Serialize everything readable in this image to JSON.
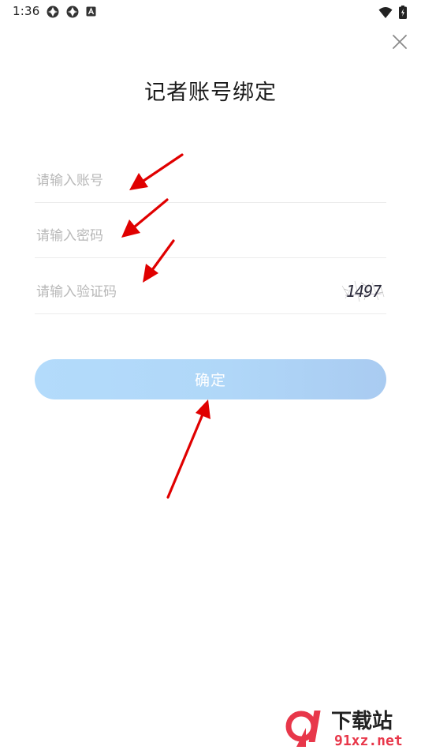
{
  "status_bar": {
    "time": "1:36",
    "left_icons": [
      "sync-icon",
      "sync-icon",
      "app-notification-icon"
    ],
    "right_icons": [
      "wifi-icon",
      "battery-icon"
    ]
  },
  "header": {
    "close_icon": "close-icon"
  },
  "title": "记者账号绑定",
  "form": {
    "account_placeholder": "请输入账号",
    "account_value": "",
    "password_placeholder": "请输入密码",
    "password_value": "",
    "captcha_placeholder": "请输入验证码",
    "captcha_value": "",
    "captcha_code": "1497"
  },
  "confirm_label": "确定",
  "colors": {
    "confirm_button": "#b0d7f8",
    "annotation_arrow": "#e00000",
    "watermark_red": "#e8374a"
  },
  "watermark": {
    "logo_text": "9l",
    "brand_text": "下载站",
    "domain": "91xz.net"
  }
}
